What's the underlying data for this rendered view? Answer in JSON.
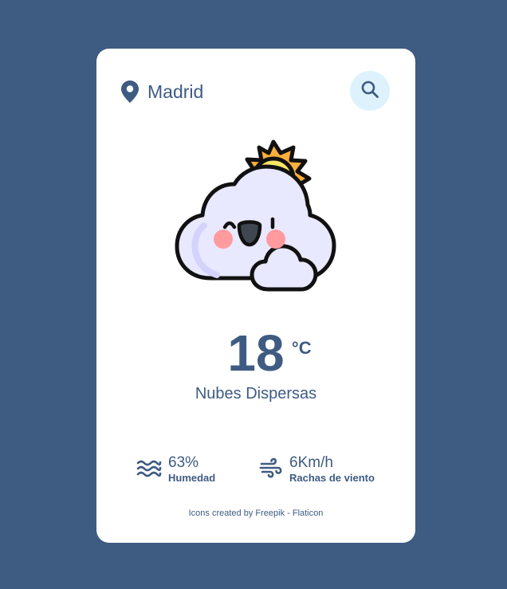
{
  "location": {
    "city": "Madrid",
    "pin_icon": "map-pin-icon"
  },
  "search": {
    "icon": "search-icon"
  },
  "weather": {
    "icon": "cloud-sun-icon",
    "temperature": "18",
    "unit": "°C",
    "description": "Nubes Dispersas"
  },
  "stats": {
    "humidity": {
      "icon": "waves-icon",
      "value": "63%",
      "label": "Humedad"
    },
    "wind": {
      "icon": "wind-icon",
      "value": "6Km/h",
      "label": "Rachas de viento"
    }
  },
  "credits": "Icons created by Freepik - Flaticon",
  "colors": {
    "background": "#3e5b82",
    "card": "#ffffff",
    "text": "#3e5b82",
    "search_bg": "#ddf2fc",
    "cloud": "#e8e8ff",
    "sun": "#fbb03b",
    "cheek": "#ff9a9e"
  }
}
